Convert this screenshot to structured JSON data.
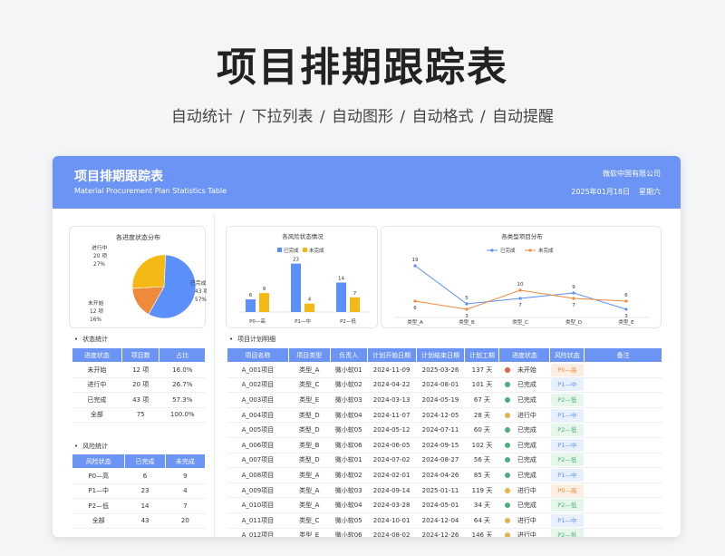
{
  "header": {
    "title": "项目排期跟踪表",
    "subtitle": "自动统计 / 下拉列表 / 自动图形  / 自动格式 / 自动提醒"
  },
  "card": {
    "title": "项目排期跟踪表",
    "subtitle_en": "Material Procurement Plan Statistics Table",
    "company": "微软中国有限公司",
    "date": "2025年01月18日",
    "weekday": "星期六"
  },
  "colors": {
    "accent": "#6b94f5",
    "orange": "#ef8a3b",
    "yellow": "#f5b915",
    "blue": "#5b8ff9"
  },
  "pie": {
    "title": "各进度状态分布",
    "slices": [
      {
        "name": "已完成",
        "count": "43 项",
        "pct": "57%",
        "value": 43,
        "color": "#5b8ff9"
      },
      {
        "name": "未开始",
        "count": "12 项",
        "pct": "16%",
        "value": 12,
        "color": "#ef8a3b"
      },
      {
        "name": "进行中",
        "count": "20 项",
        "pct": "27%",
        "value": 20,
        "color": "#f5b915"
      }
    ]
  },
  "status_table": {
    "label": "状态统计",
    "headers": [
      "进度状态",
      "项目数",
      "占比"
    ],
    "rows": [
      [
        "未开始",
        "12 项",
        "16.0%"
      ],
      [
        "进行中",
        "20 项",
        "26.7%"
      ],
      [
        "已完成",
        "43 项",
        "57.3%"
      ],
      [
        "全部",
        "75",
        "100.0%"
      ]
    ]
  },
  "risk_table": {
    "label": "风险统计",
    "headers": [
      "风险状态",
      "已完成",
      "未完成"
    ],
    "rows": [
      [
        "P0—高",
        "6",
        "9"
      ],
      [
        "P1—中",
        "23",
        "4"
      ],
      [
        "P2—低",
        "14",
        "7"
      ],
      [
        "全部",
        "43",
        "20"
      ]
    ]
  },
  "chart_data": [
    {
      "type": "bar",
      "title": "各风险状态情况",
      "categories": [
        "P0—高",
        "P1—中",
        "P2—低"
      ],
      "series": [
        {
          "name": "已完成",
          "values": [
            6,
            23,
            14
          ],
          "color": "#5b8ff9"
        },
        {
          "name": "未完成",
          "values": [
            9,
            4,
            7
          ],
          "color": "#f5b915"
        }
      ]
    },
    {
      "type": "line",
      "title": "各类型项目分布",
      "categories": [
        "类型_A",
        "类型_B",
        "类型_C",
        "类型_D",
        "类型_E"
      ],
      "series": [
        {
          "name": "已完成",
          "values": [
            19,
            5,
            7,
            9,
            3
          ],
          "color": "#5b8ff9"
        },
        {
          "name": "未完成",
          "values": [
            6,
            3,
            10,
            7,
            6
          ],
          "color": "#ef8a3b"
        }
      ]
    }
  ],
  "detail": {
    "label": "项目计划明细",
    "headers": [
      "项目名称",
      "项目类型",
      "负责人",
      "计划开始日期",
      "计划结束日期",
      "计划工期",
      "进度状态",
      "风险状态",
      "备注"
    ],
    "rows": [
      [
        "A_001项目",
        "类型_A",
        "微小软01",
        "2024-11-09",
        "2025-03-26",
        "137 天",
        "未开始",
        "P0—高"
      ],
      [
        "A_002项目",
        "类型_C",
        "微小软02",
        "2024-04-22",
        "2024-08-01",
        "101 天",
        "已完成",
        "P1—中"
      ],
      [
        "A_003项目",
        "类型_E",
        "微小软03",
        "2024-03-13",
        "2024-05-19",
        "67 天",
        "已完成",
        "P2—低"
      ],
      [
        "A_004项目",
        "类型_D",
        "微小软04",
        "2024-11-07",
        "2024-12-05",
        "28 天",
        "进行中",
        "P1—中"
      ],
      [
        "A_005项目",
        "类型_D",
        "微小软05",
        "2024-05-12",
        "2024-07-11",
        "60 天",
        "已完成",
        "P2—低"
      ],
      [
        "A_006项目",
        "类型_B",
        "微小软06",
        "2024-06-05",
        "2024-09-15",
        "102 天",
        "已完成",
        "P1—中"
      ],
      [
        "A_007项目",
        "类型_D",
        "微小软01",
        "2024-07-02",
        "2024-08-27",
        "56 天",
        "已完成",
        "P2—低"
      ],
      [
        "A_008项目",
        "类型_A",
        "微小软02",
        "2024-02-01",
        "2024-04-26",
        "85 天",
        "已完成",
        "P1—中"
      ],
      [
        "A_009项目",
        "类型_A",
        "微小软03",
        "2024-09-14",
        "2025-01-11",
        "119 天",
        "进行中",
        "P0—高"
      ],
      [
        "A_010项目",
        "类型_A",
        "微小软04",
        "2024-03-28",
        "2024-05-01",
        "34 天",
        "已完成",
        "P2—低"
      ],
      [
        "A_011项目",
        "类型_C",
        "微小软05",
        "2024-10-01",
        "2024-12-04",
        "64 天",
        "进行中",
        "P1—中"
      ],
      [
        "A_012项目",
        "类型_E",
        "微小软06",
        "2024-08-02",
        "2024-12-26",
        "146 天",
        "进行中",
        "P2—低"
      ]
    ]
  }
}
